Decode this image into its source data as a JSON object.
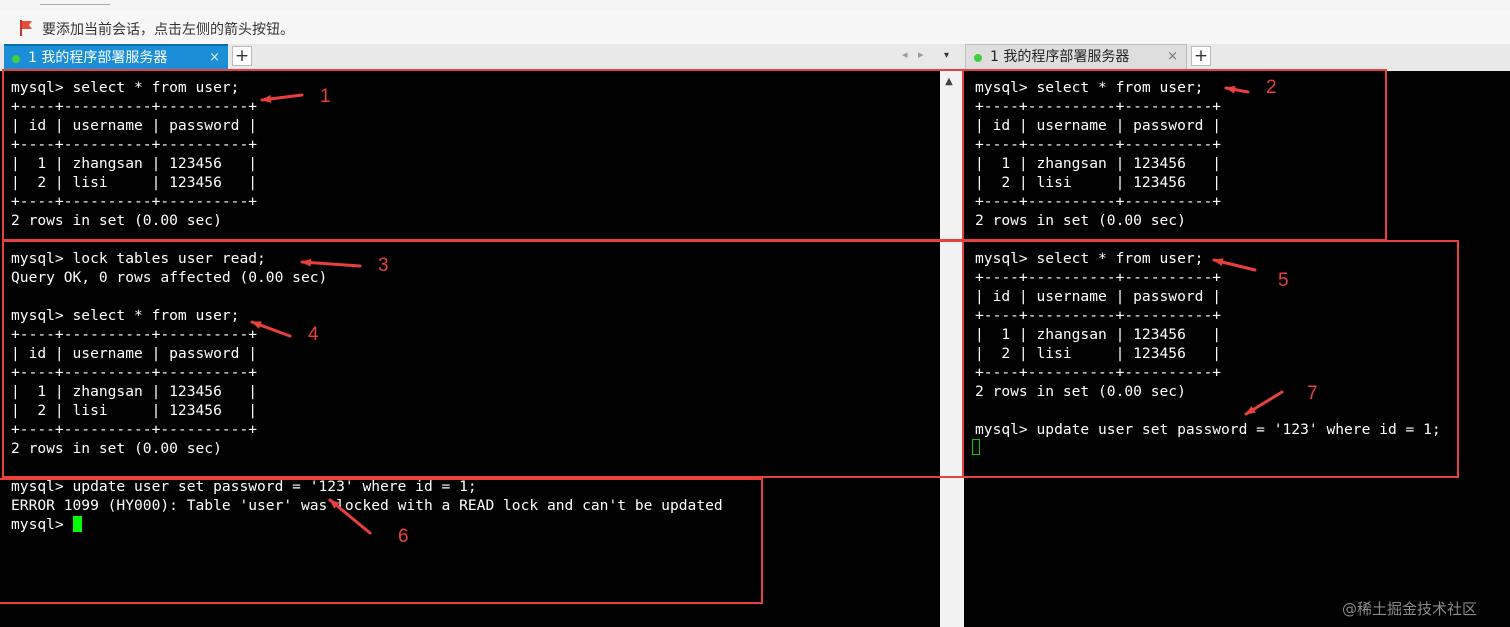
{
  "hint_bar": {
    "icon": "flag-icon",
    "text": "要添加当前会话，点击左侧的箭头按钮。"
  },
  "tabs": [
    {
      "status": "connected",
      "label": "1 我的程序部署服务器",
      "close": "×",
      "active": true
    },
    {
      "status": "connected",
      "label": "1 我的程序部署服务器",
      "close": "×",
      "active": false
    }
  ],
  "tab_controls": {
    "add": "+",
    "prev": "◂",
    "next": "▸",
    "menu": "▾"
  },
  "left_terminal": {
    "lines": [
      "mysql> select * from user;",
      "+----+----------+----------+",
      "| id | username | password |",
      "+----+----------+----------+",
      "|  1 | zhangsan | 123456   |",
      "|  2 | lisi     | 123456   |",
      "+----+----------+----------+",
      "2 rows in set (0.00 sec)",
      "",
      "mysql> lock tables user read;",
      "Query OK, 0 rows affected (0.00 sec)",
      "",
      "mysql> select * from user;",
      "+----+----------+----------+",
      "| id | username | password |",
      "+----+----------+----------+",
      "|  1 | zhangsan | 123456   |",
      "|  2 | lisi     | 123456   |",
      "+----+----------+----------+",
      "2 rows in set (0.00 sec)",
      "",
      "mysql> update user set password = '123' where id = 1;",
      "ERROR 1099 (HY000): Table 'user' was locked with a READ lock and can't be updated"
    ],
    "prompt": "mysql> "
  },
  "right_terminal": {
    "lines": [
      "mysql> select * from user;",
      "+----+----------+----------+",
      "| id | username | password |",
      "+----+----------+----------+",
      "|  1 | zhangsan | 123456   |",
      "|  2 | lisi     | 123456   |",
      "+----+----------+----------+",
      "2 rows in set (0.00 sec)",
      "",
      "mysql> select * from user;",
      "+----+----------+----------+",
      "| id | username | password |",
      "+----+----------+----------+",
      "|  1 | zhangsan | 123456   |",
      "|  2 | lisi     | 123456   |",
      "+----+----------+----------+",
      "2 rows in set (0.00 sec)",
      "",
      "mysql> update user set password = '123' where id = 1;"
    ]
  },
  "annotations": [
    "1",
    "2",
    "3",
    "4",
    "5",
    "6",
    "7"
  ],
  "annotation_color": "#e8403c",
  "terminal_colors": {
    "background": "#000000",
    "text": "#ffffff",
    "cursor": "#00ff00"
  },
  "tab_active_color": "#1a8fd8",
  "watermark": "@稀土掘金技术社区"
}
